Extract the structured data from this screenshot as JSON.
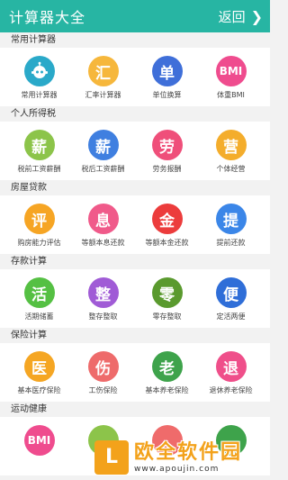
{
  "header": {
    "title": "计算器大全",
    "back_label": "返回",
    "back_icon": "chevron-right-icon"
  },
  "sections": [
    {
      "title": "常用计算器",
      "items": [
        {
          "glyph": "",
          "label": "常用计算器",
          "color": "#2aa9c9",
          "icon": "robot-icon"
        },
        {
          "glyph": "汇",
          "label": "汇率计算器",
          "color": "#f6b73c"
        },
        {
          "glyph": "单",
          "label": "单位换算",
          "color": "#3f6fd9"
        },
        {
          "glyph": "BMI",
          "label": "体重BMI",
          "color": "#ef4c8e"
        }
      ]
    },
    {
      "title": "个人所得税",
      "items": [
        {
          "glyph": "薪",
          "label": "税前工资薪酬",
          "color": "#8cc44a"
        },
        {
          "glyph": "薪",
          "label": "税后工资薪酬",
          "color": "#3f7fe0"
        },
        {
          "glyph": "劳",
          "label": "劳务报酬",
          "color": "#ef4f7a"
        },
        {
          "glyph": "营",
          "label": "个体经营",
          "color": "#f4ad2c"
        }
      ]
    },
    {
      "title": "房屋贷款",
      "items": [
        {
          "glyph": "评",
          "label": "购房能力评估",
          "color": "#f6a524"
        },
        {
          "glyph": "息",
          "label": "等额本息还款",
          "color": "#f05a8a"
        },
        {
          "glyph": "金",
          "label": "等额本金还款",
          "color": "#ec3c3c"
        },
        {
          "glyph": "提",
          "label": "提前还款",
          "color": "#3b86e8"
        }
      ]
    },
    {
      "title": "存款计算",
      "items": [
        {
          "glyph": "活",
          "label": "活期储蓄",
          "color": "#55c043"
        },
        {
          "glyph": "整",
          "label": "整存整取",
          "color": "#a05bd6"
        },
        {
          "glyph": "零",
          "label": "零存整取",
          "color": "#5a9a2e"
        },
        {
          "glyph": "便",
          "label": "定活两便",
          "color": "#2f6ed8"
        }
      ]
    },
    {
      "title": "保险计算",
      "items": [
        {
          "glyph": "医",
          "label": "基本医疗保险",
          "color": "#f5a623"
        },
        {
          "glyph": "伤",
          "label": "工伤保险",
          "color": "#ee6b6b"
        },
        {
          "glyph": "老",
          "label": "基本养老保险",
          "color": "#3ea34b"
        },
        {
          "glyph": "退",
          "label": "退休养老保险",
          "color": "#ef4f8a"
        }
      ]
    },
    {
      "title": "运动健康",
      "items": [
        {
          "glyph": "BMI",
          "label": "",
          "color": "#ef4c8e"
        },
        {
          "glyph": "",
          "label": "",
          "color": "#8cc44a"
        },
        {
          "glyph": "",
          "label": "",
          "color": "#ef6b6b"
        },
        {
          "glyph": "",
          "label": "",
          "color": "#3ea34b"
        }
      ]
    }
  ],
  "watermark": {
    "cn": "欧全软件园",
    "url": "www.apoujin.com",
    "logo_glyph": "L"
  }
}
